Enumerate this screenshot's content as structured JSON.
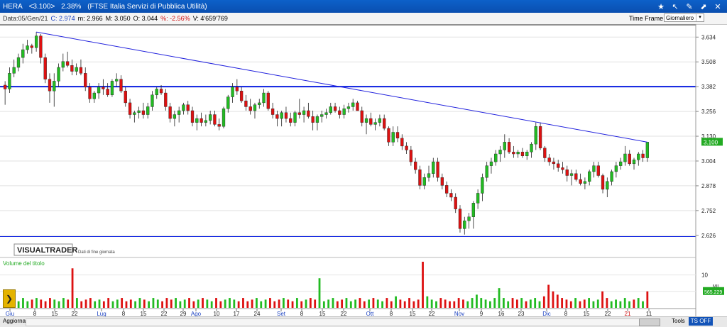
{
  "window": {
    "symbol": "HERA",
    "last_price": "<3.100>",
    "change_pct": "2.38%",
    "description": "(FTSE Italia Servizi di Pubblica Utilità)",
    "icons": [
      "pin-icon",
      "arrow-icon",
      "edit-icon",
      "share-icon",
      "close-icon"
    ]
  },
  "infobar": {
    "date": "Data:05/Gen/21",
    "close": "C: 2.974",
    "min": "m: 2.966",
    "max": "M: 3.050",
    "open": "O: 3.044",
    "var": "%: -2.56%",
    "volume": "V: 4'659'769",
    "timeframe_label": "Time Frame",
    "timeframe_value": "Giornaliero"
  },
  "branding": {
    "logo": "VISUALTRADER",
    "subtitle": "Dati di fine giornata"
  },
  "volume_panel": {
    "title": "Volume del titolo",
    "tick_10": "10",
    "tick_mil": "MIL",
    "last": "565.229"
  },
  "bottombar": {
    "update": "Aggiorna",
    "tools": "Tools",
    "ts": "TS OFF"
  },
  "chart_data": {
    "type": "candlestick",
    "y_ticks": [
      "3.634",
      "3.508",
      "3.382",
      "3.256",
      "3.130",
      "3.004",
      "2.878",
      "2.752",
      "2.626"
    ],
    "y_range": [
      2.6,
      3.7
    ],
    "last_price_label": "3.100",
    "x_labels": [
      "Giu",
      "8",
      "15",
      "22",
      "Lug",
      "8",
      "15",
      "22",
      "29",
      "Ago",
      "10",
      "17",
      "24",
      "Set",
      "8",
      "15",
      "22",
      "Ott",
      "8",
      "15",
      "22",
      "Nov",
      "9",
      "16",
      "23",
      "Dic",
      "8",
      "15",
      "22",
      "21",
      "11"
    ],
    "horizontal_lines": [
      3.382,
      2.62
    ],
    "trendline": [
      [
        3.66,
        0
      ],
      [
        3.1,
        1
      ]
    ],
    "colors": {
      "up": "#22bb22",
      "down": "#dd1111",
      "trend": "#2222dd",
      "support": "#0a1ee0"
    },
    "candles": [
      [
        3.39,
        3.41,
        3.29,
        3.37
      ],
      [
        3.37,
        3.48,
        3.35,
        3.45
      ],
      [
        3.45,
        3.52,
        3.43,
        3.48
      ],
      [
        3.48,
        3.55,
        3.46,
        3.53
      ],
      [
        3.53,
        3.6,
        3.5,
        3.57
      ],
      [
        3.57,
        3.62,
        3.55,
        3.59
      ],
      [
        3.59,
        3.6,
        3.55,
        3.58
      ],
      [
        3.58,
        3.66,
        3.56,
        3.64
      ],
      [
        3.64,
        3.65,
        3.5,
        3.53
      ],
      [
        3.53,
        3.55,
        3.4,
        3.42
      ],
      [
        3.42,
        3.45,
        3.3,
        3.36
      ],
      [
        3.36,
        3.45,
        3.28,
        3.41
      ],
      [
        3.41,
        3.5,
        3.38,
        3.48
      ],
      [
        3.48,
        3.55,
        3.46,
        3.51
      ],
      [
        3.51,
        3.56,
        3.48,
        3.49
      ],
      [
        3.49,
        3.52,
        3.44,
        3.46
      ],
      [
        3.46,
        3.5,
        3.44,
        3.48
      ],
      [
        3.48,
        3.52,
        3.44,
        3.45
      ],
      [
        3.45,
        3.48,
        3.36,
        3.38
      ],
      [
        3.38,
        3.4,
        3.3,
        3.32
      ],
      [
        3.32,
        3.36,
        3.3,
        3.35
      ],
      [
        3.35,
        3.4,
        3.32,
        3.38
      ],
      [
        3.38,
        3.42,
        3.34,
        3.37
      ],
      [
        3.37,
        3.4,
        3.33,
        3.34
      ],
      [
        3.34,
        3.42,
        3.33,
        3.41
      ],
      [
        3.41,
        3.45,
        3.38,
        3.42
      ],
      [
        3.42,
        3.44,
        3.35,
        3.36
      ],
      [
        3.36,
        3.38,
        3.28,
        3.3
      ],
      [
        3.3,
        3.32,
        3.22,
        3.24
      ],
      [
        3.24,
        3.26,
        3.2,
        3.25
      ],
      [
        3.25,
        3.28,
        3.22,
        3.26
      ],
      [
        3.26,
        3.3,
        3.22,
        3.24
      ],
      [
        3.24,
        3.3,
        3.22,
        3.28
      ],
      [
        3.28,
        3.36,
        3.26,
        3.34
      ],
      [
        3.34,
        3.38,
        3.32,
        3.37
      ],
      [
        3.37,
        3.39,
        3.34,
        3.35
      ],
      [
        3.35,
        3.37,
        3.26,
        3.28
      ],
      [
        3.28,
        3.3,
        3.2,
        3.22
      ],
      [
        3.22,
        3.26,
        3.18,
        3.24
      ],
      [
        3.24,
        3.28,
        3.2,
        3.26
      ],
      [
        3.26,
        3.3,
        3.24,
        3.29
      ],
      [
        3.29,
        3.31,
        3.24,
        3.26
      ],
      [
        3.26,
        3.28,
        3.18,
        3.2
      ],
      [
        3.2,
        3.24,
        3.16,
        3.22
      ],
      [
        3.22,
        3.25,
        3.18,
        3.2
      ],
      [
        3.2,
        3.24,
        3.18,
        3.21
      ],
      [
        3.21,
        3.26,
        3.19,
        3.24
      ],
      [
        3.24,
        3.26,
        3.18,
        3.19
      ],
      [
        3.19,
        3.22,
        3.16,
        3.18
      ],
      [
        3.18,
        3.28,
        3.17,
        3.27
      ],
      [
        3.27,
        3.34,
        3.25,
        3.33
      ],
      [
        3.33,
        3.4,
        3.3,
        3.38
      ],
      [
        3.38,
        3.42,
        3.34,
        3.36
      ],
      [
        3.36,
        3.38,
        3.3,
        3.31
      ],
      [
        3.31,
        3.34,
        3.26,
        3.28
      ],
      [
        3.28,
        3.32,
        3.24,
        3.26
      ],
      [
        3.26,
        3.3,
        3.22,
        3.29
      ],
      [
        3.29,
        3.32,
        3.27,
        3.3
      ],
      [
        3.3,
        3.37,
        3.28,
        3.35
      ],
      [
        3.35,
        3.36,
        3.26,
        3.27
      ],
      [
        3.27,
        3.3,
        3.22,
        3.24
      ],
      [
        3.24,
        3.26,
        3.18,
        3.22
      ],
      [
        3.22,
        3.26,
        3.18,
        3.25
      ],
      [
        3.25,
        3.28,
        3.2,
        3.22
      ],
      [
        3.22,
        3.25,
        3.18,
        3.2
      ],
      [
        3.2,
        3.26,
        3.18,
        3.25
      ],
      [
        3.25,
        3.32,
        3.22,
        3.24
      ],
      [
        3.24,
        3.28,
        3.2,
        3.26
      ],
      [
        3.26,
        3.3,
        3.22,
        3.23
      ],
      [
        3.23,
        3.26,
        3.16,
        3.2
      ],
      [
        3.2,
        3.24,
        3.16,
        3.23
      ],
      [
        3.23,
        3.26,
        3.2,
        3.24
      ],
      [
        3.24,
        3.27,
        3.22,
        3.25
      ],
      [
        3.25,
        3.3,
        3.24,
        3.28
      ],
      [
        3.28,
        3.3,
        3.25,
        3.26
      ],
      [
        3.26,
        3.28,
        3.22,
        3.24
      ],
      [
        3.24,
        3.29,
        3.22,
        3.27
      ],
      [
        3.27,
        3.3,
        3.25,
        3.28
      ],
      [
        3.28,
        3.32,
        3.26,
        3.3
      ],
      [
        3.3,
        3.31,
        3.26,
        3.26
      ],
      [
        3.26,
        3.28,
        3.18,
        3.2
      ],
      [
        3.2,
        3.24,
        3.14,
        3.22
      ],
      [
        3.22,
        3.25,
        3.18,
        3.19
      ],
      [
        3.19,
        3.22,
        3.16,
        3.2
      ],
      [
        3.2,
        3.24,
        3.18,
        3.22
      ],
      [
        3.22,
        3.24,
        3.16,
        3.17
      ],
      [
        3.17,
        3.18,
        3.08,
        3.1
      ],
      [
        3.1,
        3.18,
        3.08,
        3.15
      ],
      [
        3.15,
        3.18,
        3.1,
        3.12
      ],
      [
        3.12,
        3.14,
        3.06,
        3.08
      ],
      [
        3.08,
        3.1,
        3.04,
        3.06
      ],
      [
        3.06,
        3.08,
        2.98,
        3.0
      ],
      [
        3.0,
        3.02,
        2.94,
        2.96
      ],
      [
        2.96,
        2.98,
        2.86,
        2.88
      ],
      [
        2.88,
        2.94,
        2.86,
        2.92
      ],
      [
        2.92,
        2.98,
        2.9,
        2.94
      ],
      [
        2.94,
        3.02,
        2.92,
        3.0
      ],
      [
        3.0,
        3.02,
        2.9,
        2.92
      ],
      [
        2.92,
        2.94,
        2.86,
        2.88
      ],
      [
        2.88,
        2.9,
        2.82,
        2.84
      ],
      [
        2.84,
        2.86,
        2.8,
        2.82
      ],
      [
        2.82,
        2.84,
        2.74,
        2.76
      ],
      [
        2.76,
        2.78,
        2.64,
        2.66
      ],
      [
        2.66,
        2.72,
        2.63,
        2.7
      ],
      [
        2.7,
        2.74,
        2.66,
        2.72
      ],
      [
        2.72,
        2.8,
        2.66,
        2.79
      ],
      [
        2.79,
        2.86,
        2.76,
        2.84
      ],
      [
        2.84,
        2.94,
        2.8,
        2.92
      ],
      [
        2.92,
        3.0,
        2.9,
        2.98
      ],
      [
        2.98,
        3.02,
        2.94,
        3.0
      ],
      [
        3.0,
        3.06,
        2.98,
        3.04
      ],
      [
        3.04,
        3.08,
        3.0,
        3.06
      ],
      [
        3.06,
        3.14,
        3.02,
        3.1
      ],
      [
        3.1,
        3.12,
        3.04,
        3.05
      ],
      [
        3.05,
        3.08,
        3.02,
        3.04
      ],
      [
        3.04,
        3.06,
        3.02,
        3.05
      ],
      [
        3.05,
        3.07,
        3.02,
        3.03
      ],
      [
        3.03,
        3.06,
        3.01,
        3.05
      ],
      [
        3.05,
        3.1,
        3.02,
        3.09
      ],
      [
        3.09,
        3.2,
        3.06,
        3.18
      ],
      [
        3.18,
        3.2,
        3.06,
        3.07
      ],
      [
        3.07,
        3.08,
        3.0,
        3.02
      ],
      [
        3.02,
        3.04,
        2.98,
        3.0
      ],
      [
        3.0,
        3.02,
        2.96,
        2.99
      ],
      [
        2.99,
        3.01,
        2.95,
        2.97
      ],
      [
        2.97,
        3.0,
        2.94,
        2.96
      ],
      [
        2.96,
        2.98,
        2.9,
        2.93
      ],
      [
        2.93,
        2.96,
        2.88,
        2.94
      ],
      [
        2.94,
        2.96,
        2.9,
        2.91
      ],
      [
        2.91,
        2.94,
        2.88,
        2.89
      ],
      [
        2.89,
        2.92,
        2.86,
        2.9
      ],
      [
        2.9,
        2.96,
        2.88,
        2.95
      ],
      [
        2.95,
        3.0,
        2.92,
        2.98
      ],
      [
        2.98,
        3.0,
        2.92,
        2.93
      ],
      [
        2.93,
        2.94,
        2.84,
        2.86
      ],
      [
        2.86,
        2.92,
        2.82,
        2.9
      ],
      [
        2.9,
        2.96,
        2.88,
        2.95
      ],
      [
        2.95,
        3.0,
        2.92,
        2.98
      ],
      [
        2.98,
        3.02,
        2.96,
        3.0
      ],
      [
        3.0,
        3.08,
        2.98,
        3.04
      ],
      [
        3.04,
        3.06,
        2.98,
        2.99
      ],
      [
        2.99,
        3.02,
        2.96,
        3.01
      ],
      [
        3.01,
        3.05,
        2.98,
        3.04
      ],
      [
        3.04,
        3.06,
        3.0,
        3.02
      ],
      [
        3.02,
        3.1,
        3.0,
        3.1
      ]
    ],
    "volumes": [
      5,
      3,
      2.5,
      2,
      3,
      2,
      2.5,
      3,
      2.5,
      2,
      3,
      2.5,
      2,
      3,
      2.5,
      12,
      3,
      2,
      2.5,
      3,
      2,
      2.5,
      2,
      3,
      2,
      2.5,
      3,
      2,
      2.5,
      2,
      3,
      2.5,
      2,
      3,
      2.5,
      2,
      3,
      2.5,
      3,
      2,
      2.5,
      3,
      2,
      2.5,
      3,
      2.5,
      2,
      3,
      2,
      2.5,
      3,
      2.5,
      2,
      3,
      2,
      2.5,
      3,
      2,
      2.5,
      3,
      2,
      2.5,
      3,
      2.5,
      2,
      3,
      2,
      2.5,
      3,
      2.5,
      9,
      2,
      2.5,
      3,
      2,
      2.5,
      3,
      2,
      2.5,
      3,
      2,
      2.5,
      3,
      2.5,
      2,
      3,
      2,
      3.5,
      2.5,
      2,
      3,
      2,
      2.5,
      14,
      3.5,
      2.5,
      2,
      3,
      2.5,
      2,
      2,
      3,
      2.5,
      2,
      3,
      4,
      3,
      2.5,
      2,
      3,
      6,
      3,
      2,
      3,
      2.5,
      3,
      2,
      2.5,
      3,
      2,
      3.5,
      7,
      5,
      4,
      3,
      2.5,
      2,
      3,
      2,
      2.5,
      3,
      2,
      2.5,
      5,
      3,
      2,
      2.5,
      2,
      3,
      2,
      2.5,
      3,
      2,
      5
    ]
  }
}
